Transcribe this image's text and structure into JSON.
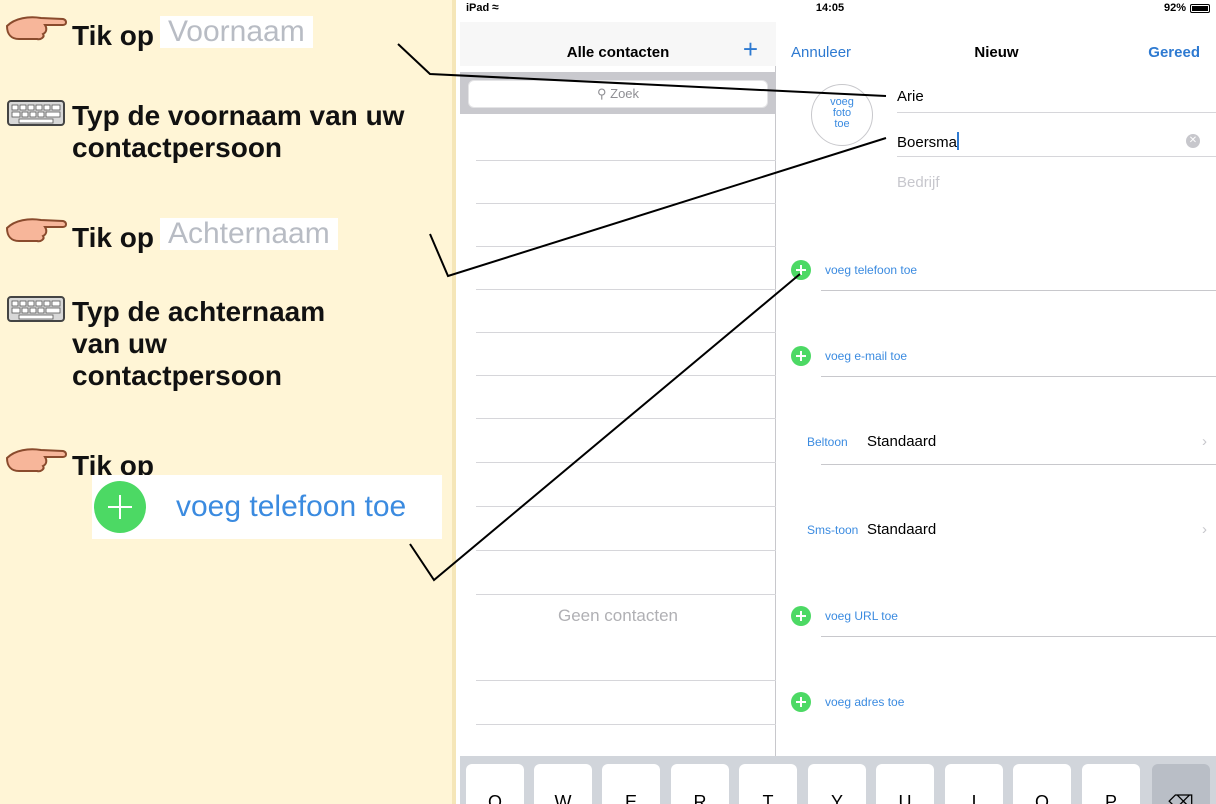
{
  "instructions": {
    "step1": {
      "prefix": "Tik op",
      "chip": "Voornaam"
    },
    "step2": {
      "text": "Typ de voornaam van uw contactpersoon"
    },
    "step3": {
      "prefix": "Tik op",
      "chip": "Achternaam"
    },
    "step4": {
      "text": "Typ de achternaam van uw contactpersoon"
    },
    "step5": {
      "prefix": "Tik op",
      "button": "voeg telefoon toe"
    }
  },
  "status": {
    "device": "iPad",
    "time": "14:05",
    "battery": "92%"
  },
  "left_pane": {
    "title": "Alle contacten",
    "add_label": "+",
    "search_placeholder": "Zoek",
    "empty_text": "Geen contacten"
  },
  "right_pane": {
    "cancel": "Annuleer",
    "title": "Nieuw",
    "done": "Gereed",
    "photo_label": "voeg foto toe",
    "first_name": "Arie",
    "last_name": "Boersma",
    "company_placeholder": "Bedrijf",
    "add_phone": "voeg telefoon toe",
    "add_email": "voeg e-mail toe",
    "ringtone_label": "Beltoon",
    "ringtone_value": "Standaard",
    "smstone_label": "Sms-toon",
    "smstone_value": "Standaard",
    "add_url": "voeg URL toe",
    "add_address": "voeg adres toe"
  },
  "keyboard": {
    "keys": [
      "Q",
      "W",
      "E",
      "R",
      "T",
      "Y",
      "U",
      "I",
      "O",
      "P"
    ],
    "backspace": "⌫"
  },
  "colors": {
    "panel": "#fff5d6",
    "accent": "#3b8be0",
    "green": "#4cd964"
  },
  "icons": {
    "pointer": "pointing-hand-icon",
    "keyboard": "keyboard-icon"
  }
}
